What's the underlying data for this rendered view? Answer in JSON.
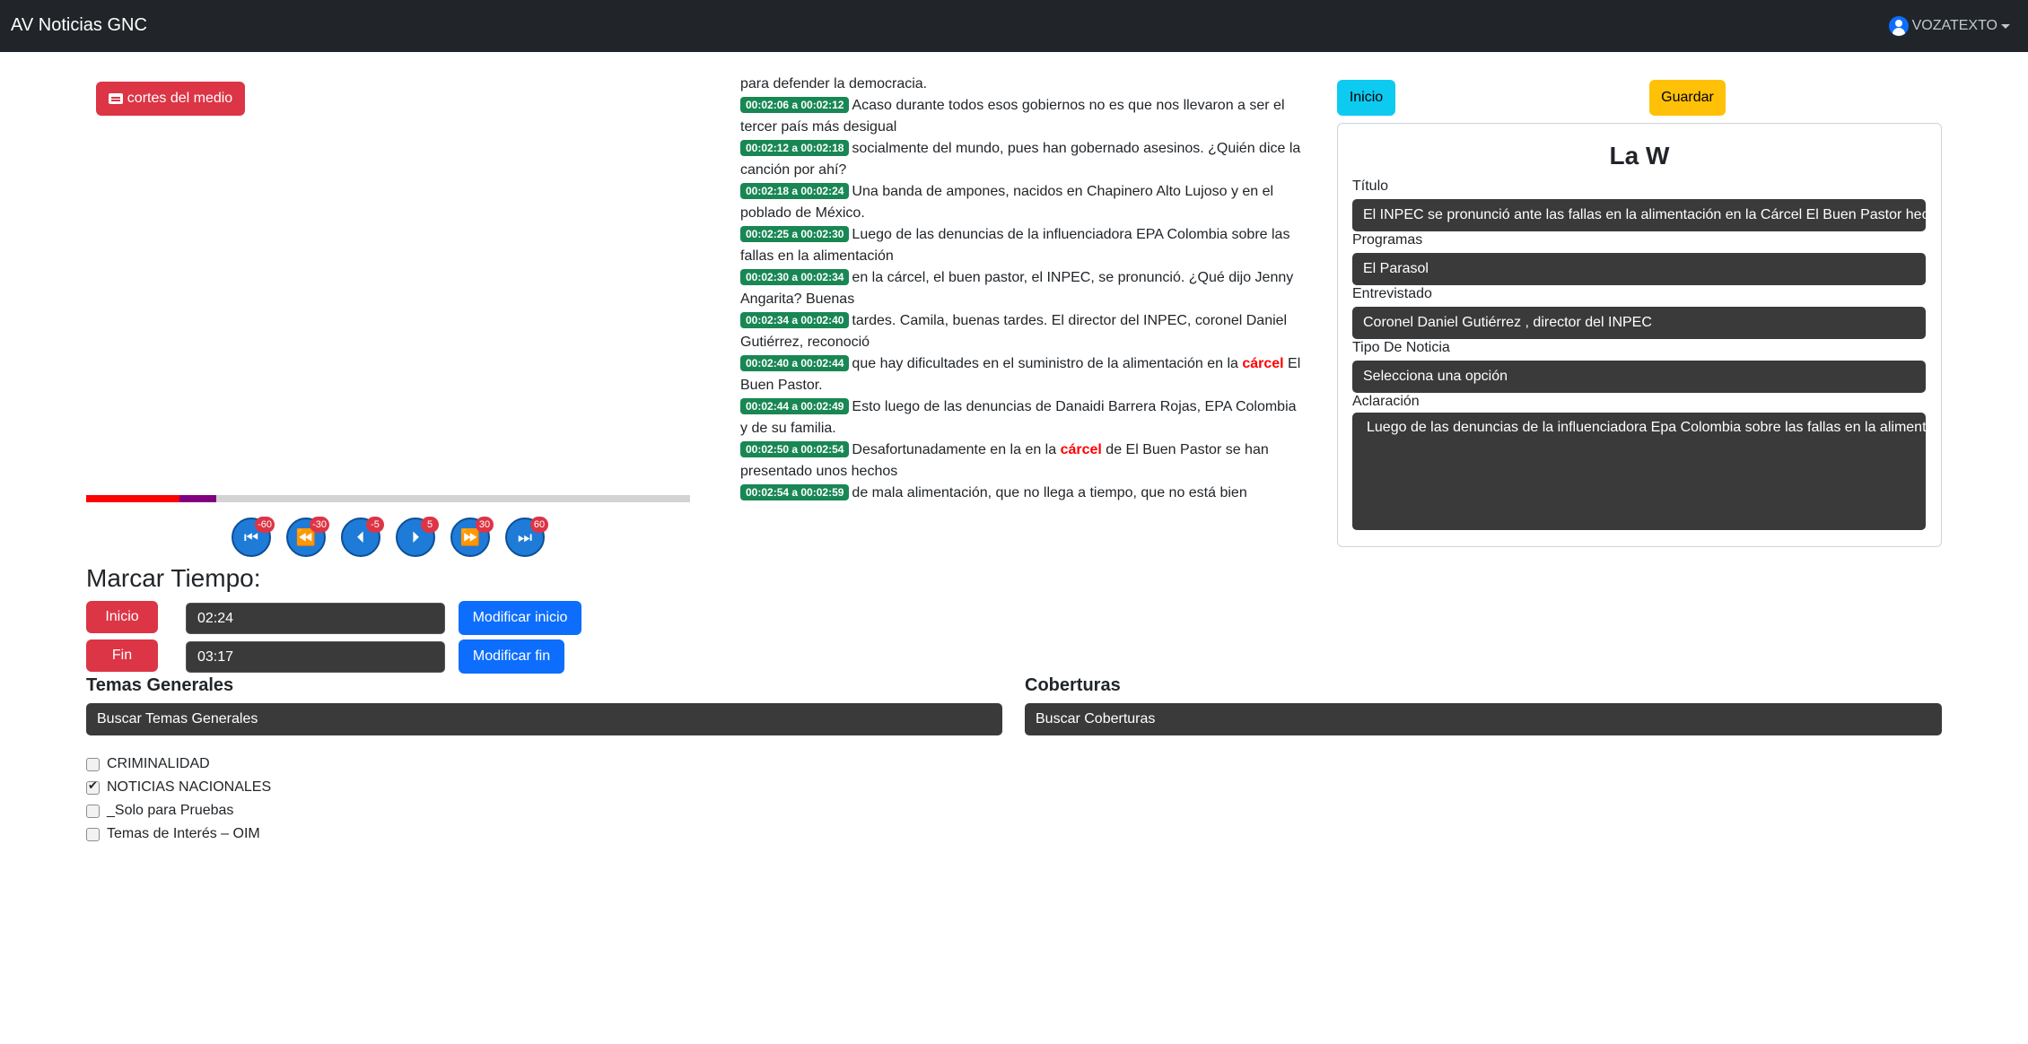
{
  "navbar": {
    "brand": "AV Noticias GNC",
    "user": "VOZATEXTO"
  },
  "player": {
    "cortes_label": "cortes del medio",
    "progress_fraction": 0.155,
    "segment_start_fraction": 0.155,
    "segment_end_fraction": 0.215,
    "controls": [
      {
        "name": "back-60-button",
        "icon": "skip-start-icon",
        "badge": "-60"
      },
      {
        "name": "back-30-button",
        "icon": "rewind-icon",
        "badge": "-30"
      },
      {
        "name": "back-5-button",
        "icon": "step-back-icon",
        "badge": "-5"
      },
      {
        "name": "forward-5-button",
        "icon": "step-forward-icon",
        "badge": "5"
      },
      {
        "name": "forward-30-button",
        "icon": "fast-forward-icon",
        "badge": "30"
      },
      {
        "name": "forward-60-button",
        "icon": "skip-end-icon",
        "badge": "60"
      }
    ]
  },
  "marcar": {
    "title": "Marcar Tiempo:",
    "inicio_label": "Inicio",
    "inicio_value": "02:24",
    "modificar_inicio": "Modificar inicio",
    "fin_label": "Fin",
    "fin_value": "03:17",
    "modificar_fin": "Modificar fin"
  },
  "transcript": {
    "lead": "para defender la democracia.",
    "segments": [
      {
        "ts": "00:02:06 a 00:02:12",
        "parts": [
          {
            "t": "Acaso durante todos esos gobiernos no es que nos llevaron a ser el tercer país más desigual"
          }
        ]
      },
      {
        "ts": "00:02:12 a 00:02:18",
        "parts": [
          {
            "t": "socialmente del mundo, pues han gobernado asesinos. ¿Quién dice la canción por ahí?"
          }
        ]
      },
      {
        "ts": "00:02:18 a 00:02:24",
        "parts": [
          {
            "t": "Una banda de ampones, nacidos en Chapinero Alto Lujoso y en el poblado de México."
          }
        ]
      },
      {
        "ts": "00:02:25 a 00:02:30",
        "parts": [
          {
            "t": "Luego de las denuncias de la influenciadora EPA Colombia sobre las fallas en la alimentación"
          }
        ]
      },
      {
        "ts": "00:02:30 a 00:02:34",
        "parts": [
          {
            "t": "en la cárcel, el buen pastor, el INPEC, se pronunció. ¿Qué dijo Jenny Angarita? Buenas"
          }
        ]
      },
      {
        "ts": "00:02:34 a 00:02:40",
        "parts": [
          {
            "t": "tardes. Camila, buenas tardes. El director del INPEC, coronel Daniel Gutiérrez, reconoció"
          }
        ]
      },
      {
        "ts": "00:02:40 a 00:02:44",
        "parts": [
          {
            "t": "que hay dificultades en el suministro de la alimentación en la "
          },
          {
            "t": "cárcel",
            "kw": true
          },
          {
            "t": " El Buen Pastor."
          }
        ]
      },
      {
        "ts": "00:02:44 a 00:02:49",
        "parts": [
          {
            "t": "Esto luego de las denuncias de Danaidi Barrera Rojas, EPA Colombia y de su familia."
          }
        ]
      },
      {
        "ts": "00:02:50 a 00:02:54",
        "parts": [
          {
            "t": "Desafortunadamente en la en la "
          },
          {
            "t": "cárcel",
            "kw": true
          },
          {
            "t": " de El Buen Pastor se han presentado unos hechos"
          }
        ]
      },
      {
        "ts": "00:02:54 a 00:02:59",
        "parts": [
          {
            "t": "de mala alimentación, que no llega a tiempo, que no está bien"
          }
        ]
      }
    ]
  },
  "form": {
    "inicio_btn": "Inicio",
    "guardar_btn": "Guardar",
    "medio": "La W",
    "titulo_label": "Título",
    "titulo_value": "El INPEC se pronunció ante las fallas en la alimentación en la Cárcel El Buen Pastor hecha por EPA Colombia",
    "programas_label": "Programas",
    "programas_value": "El Parasol",
    "entrevistado_label": "Entrevistado",
    "entrevistado_value": "Coronel Daniel Gutiérrez , director del INPEC",
    "tipo_label": "Tipo De Noticia",
    "tipo_value": "Selecciona una opción",
    "aclaracion_label": "Aclaración",
    "aclaracion_value": "Luego de las denuncias de la influenciadora Epa Colombia sobre las fallas en la alimentación en la cárcel"
  },
  "temas": {
    "title": "Temas Generales",
    "placeholder": "Buscar Temas Generales",
    "items": [
      {
        "label": "CRIMINALIDAD",
        "checked": false
      },
      {
        "label": "NOTICIAS NACIONALES",
        "checked": true
      },
      {
        "label": "_Solo para Pruebas",
        "checked": false
      },
      {
        "label": "Temas de Interés – OIM",
        "checked": false
      }
    ]
  },
  "coberturas": {
    "title": "Coberturas",
    "placeholder": "Buscar Coberturas"
  }
}
